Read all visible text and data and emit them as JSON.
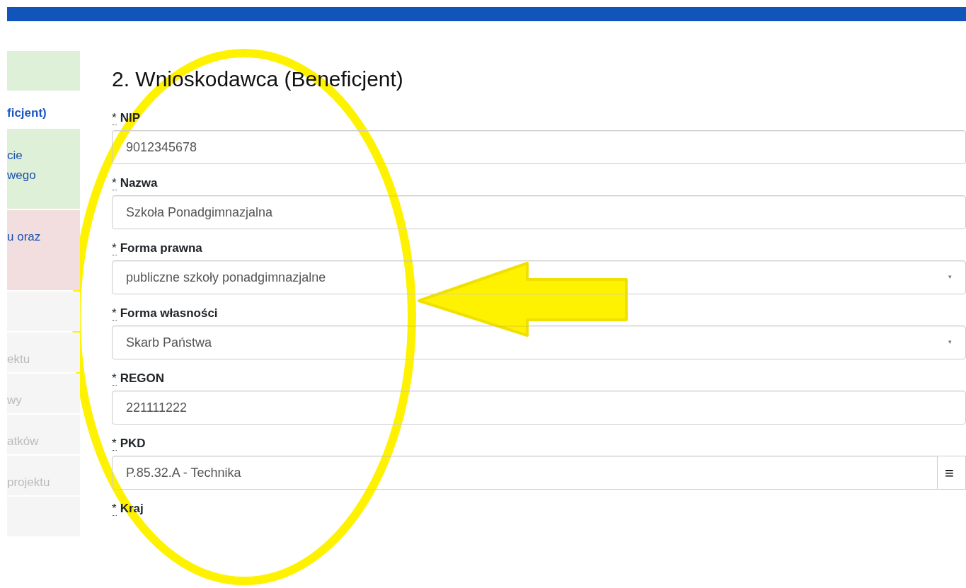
{
  "sidebar": {
    "items": [
      {
        "selected": false,
        "color": "#dff0d8"
      },
      {
        "text": "ficjent)",
        "selected": true,
        "disabled": false,
        "color": "#ffffff"
      },
      {
        "text": "cie\nwego",
        "selected": false,
        "disabled": false,
        "color": "#dff0d8"
      },
      {
        "text": "u oraz",
        "selected": false,
        "disabled": false,
        "color": "#f2dede"
      },
      {
        "selected": false,
        "color": "#f5f5f5"
      },
      {
        "text": "ektu",
        "selected": false,
        "disabled": true,
        "color": "#f5f5f5"
      },
      {
        "text": "wy",
        "selected": false,
        "disabled": true,
        "color": "#f5f5f5"
      },
      {
        "text": "atków",
        "selected": false,
        "disabled": true,
        "color": "#f5f5f5"
      },
      {
        "text": "projektu",
        "selected": false,
        "disabled": true,
        "color": "#f5f5f5"
      },
      {
        "selected": false,
        "color": "#f5f5f5"
      }
    ]
  },
  "form": {
    "title": "2. Wnioskodawca (Beneficjent)",
    "fields": [
      {
        "required_mark": "*",
        "label": "NIP",
        "kind": "text",
        "value": "9012345678"
      },
      {
        "required_mark": "*",
        "label": "Nazwa",
        "kind": "text",
        "value": "Szkoła Ponadgimnazjalna"
      },
      {
        "required_mark": "*",
        "label": "Forma prawna",
        "kind": "select",
        "value": "publiczne szkoły ponadgimnazjalne",
        "caret": "▾"
      },
      {
        "required_mark": "*",
        "label": "Forma własności",
        "kind": "select",
        "value": "Skarb Państwa",
        "caret": "▾"
      },
      {
        "required_mark": "*",
        "label": "REGON",
        "kind": "text",
        "value": "221111222"
      },
      {
        "required_mark": "*",
        "label": "PKD",
        "kind": "lookup",
        "value": "P.85.32.A - Technika",
        "button": "≡"
      },
      {
        "required_mark": "*",
        "label": "Kraj",
        "kind": "cut"
      }
    ]
  }
}
